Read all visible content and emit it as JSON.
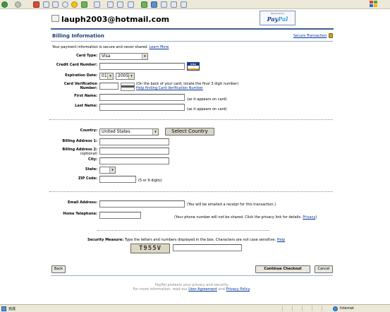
{
  "browser": {
    "status_text": "完成",
    "zone_text": "Internet"
  },
  "header": {
    "email": "lauph2003@hotmail.com",
    "paypal_small": "Payments by",
    "paypal_word_a": "Pay",
    "paypal_word_b": "Pal"
  },
  "billing": {
    "title": "Billing Information",
    "secure_link": "Secure Transaction",
    "intro_text": "Your payment information is secure and never shared.",
    "learn_more": "Learn More"
  },
  "card": {
    "type_label": "Card Type:",
    "type_value": "Visa",
    "number_label": "Credit Card Number:",
    "number_value": "",
    "visa_logo_top": "VISA",
    "expiration_label": "Expiration Date:",
    "exp_month": "01",
    "exp_year": "2005",
    "cvn_label": "Card Verification Number:",
    "cvn_note": "(On the back of your card, locate the final 3 digit number)",
    "cvn_help": "Help finding Card Verification Number",
    "first_name_label": "First Name:",
    "last_name_label": "Last Name:",
    "as_on_card": "(as it appears on card)"
  },
  "address": {
    "country_label": "Country:",
    "country_value": "United States",
    "select_country_button": "Select Country",
    "address1_label": "Billing Address 1:",
    "address2_label": "Billing Address 2:",
    "address2_optional": "(optional)",
    "city_label": "City:",
    "state_label": "State:",
    "state_value": "",
    "zip_label": "ZIP Code:",
    "zip_note": "(5 or 9 digits)"
  },
  "contact": {
    "email_label": "Email Address:",
    "email_note": "(You will be emailed a receipt for this transaction.)",
    "phone_label": "Home Telephone:",
    "phone_note": "(Your phone number will not be shared. Click the privacy link for details.",
    "privacy_link": "Privacy",
    "phone_note_end": ")"
  },
  "security": {
    "label": "Security Measure:",
    "note": "Type the letters and numbers displayed in the box. Characters are not case sensitive.",
    "help": "Help",
    "captcha_text": "T955V"
  },
  "actions": {
    "back": "Back",
    "continue": "Continue Checkout",
    "cancel": "Cancel"
  },
  "footer": {
    "line1": "PayPal protects your privacy and security.",
    "line2_prefix": "For more information, read our",
    "user_agreement": "User Agreement",
    "and": "and",
    "privacy_policy": "Privacy Policy",
    "period": "."
  },
  "colors": {
    "brand_blue": "#1c3f78",
    "link": "#003399",
    "rule": "#3c5f91"
  }
}
